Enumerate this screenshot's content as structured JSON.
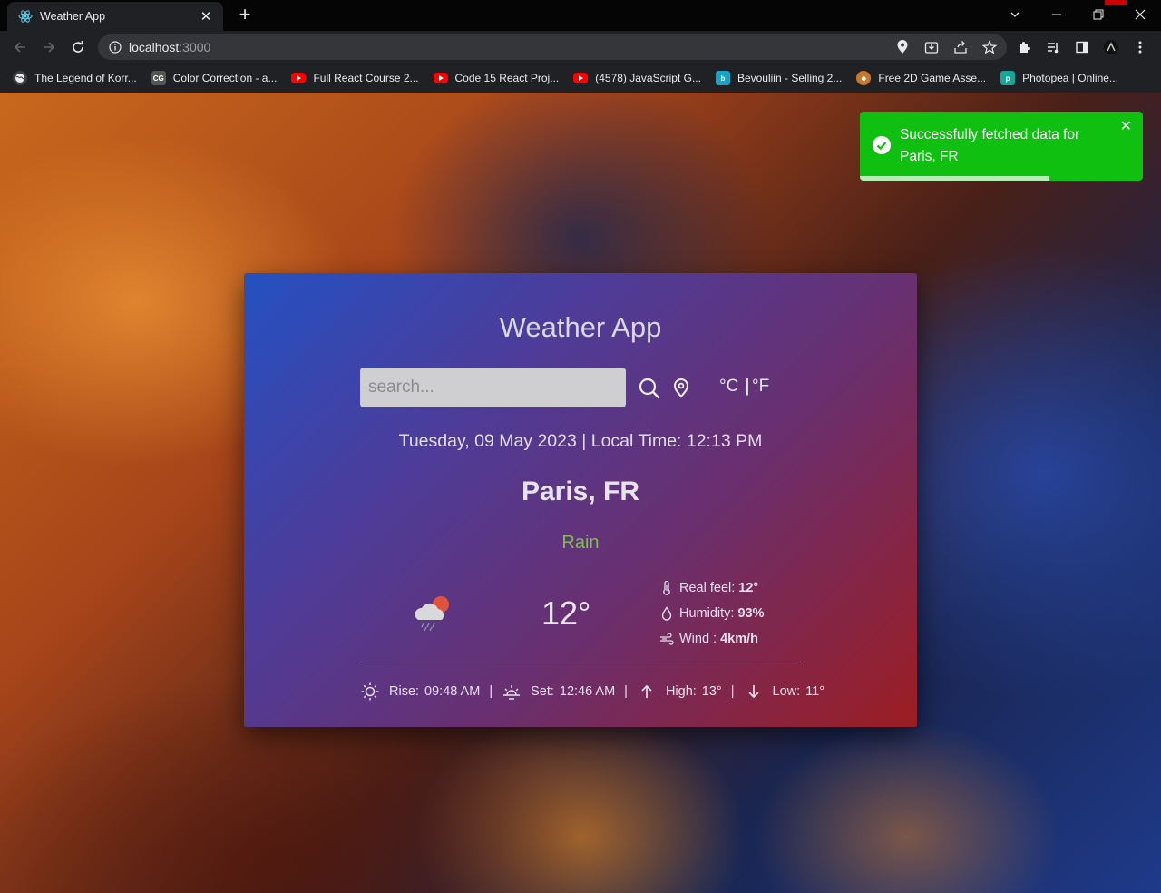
{
  "browser": {
    "tab_title": "Weather App",
    "tab_icon": "react-icon",
    "url_host": "localhost",
    "url_port": ":3000",
    "bookmarks": [
      {
        "label": "The Legend of Korr...",
        "icon": "globe-icon",
        "color": "#3c4043"
      },
      {
        "label": "Color Correction - a...",
        "icon": "cg-icon",
        "color": "#555555"
      },
      {
        "label": "Full React Course 2...",
        "icon": "youtube-icon",
        "color": "#ff0000"
      },
      {
        "label": "Code 15 React Proj...",
        "icon": "youtube-icon",
        "color": "#ff0000"
      },
      {
        "label": "(4578) JavaScript G...",
        "icon": "youtube-icon",
        "color": "#ff0000"
      },
      {
        "label": "Bevouliin - Selling 2...",
        "icon": "bevouliin-icon",
        "color": "#1aa3c9"
      },
      {
        "label": "Free 2D Game Asse...",
        "icon": "game-asset-icon",
        "color": "#c8782a"
      },
      {
        "label": "Photopea | Online...",
        "icon": "photopea-icon",
        "color": "#18a497"
      }
    ]
  },
  "app": {
    "title": "Weather App",
    "search": {
      "placeholder": "search..."
    },
    "units": {
      "celsius": "°C",
      "separator": "|",
      "fahrenheit": "°F"
    },
    "date_line": "Tuesday, 09 May 2023 | Local Time: 12:13 PM",
    "city": "Paris, FR",
    "condition": "Rain",
    "condition_color": "#7ec04a",
    "weather_icon": "cloud-sun-rain-icon",
    "temperature": "12°",
    "details": {
      "real_feel_label": "Real feel:",
      "real_feel_value": "12°",
      "humidity_label": "Humidity:",
      "humidity_value": "93%",
      "wind_label": "Wind :",
      "wind_value": "4km/h"
    },
    "bottom": {
      "rise_label": "Rise:",
      "rise_value": "09:48 AM",
      "set_label": "Set:",
      "set_value": "12:46 AM",
      "high_label": "High:",
      "high_value": "13°",
      "low_label": "Low:",
      "low_value": "11°",
      "separator": "|"
    }
  },
  "toast": {
    "message": "Successfully fetched data for Paris, FR",
    "color": "#10c010",
    "progress": 0.67
  }
}
